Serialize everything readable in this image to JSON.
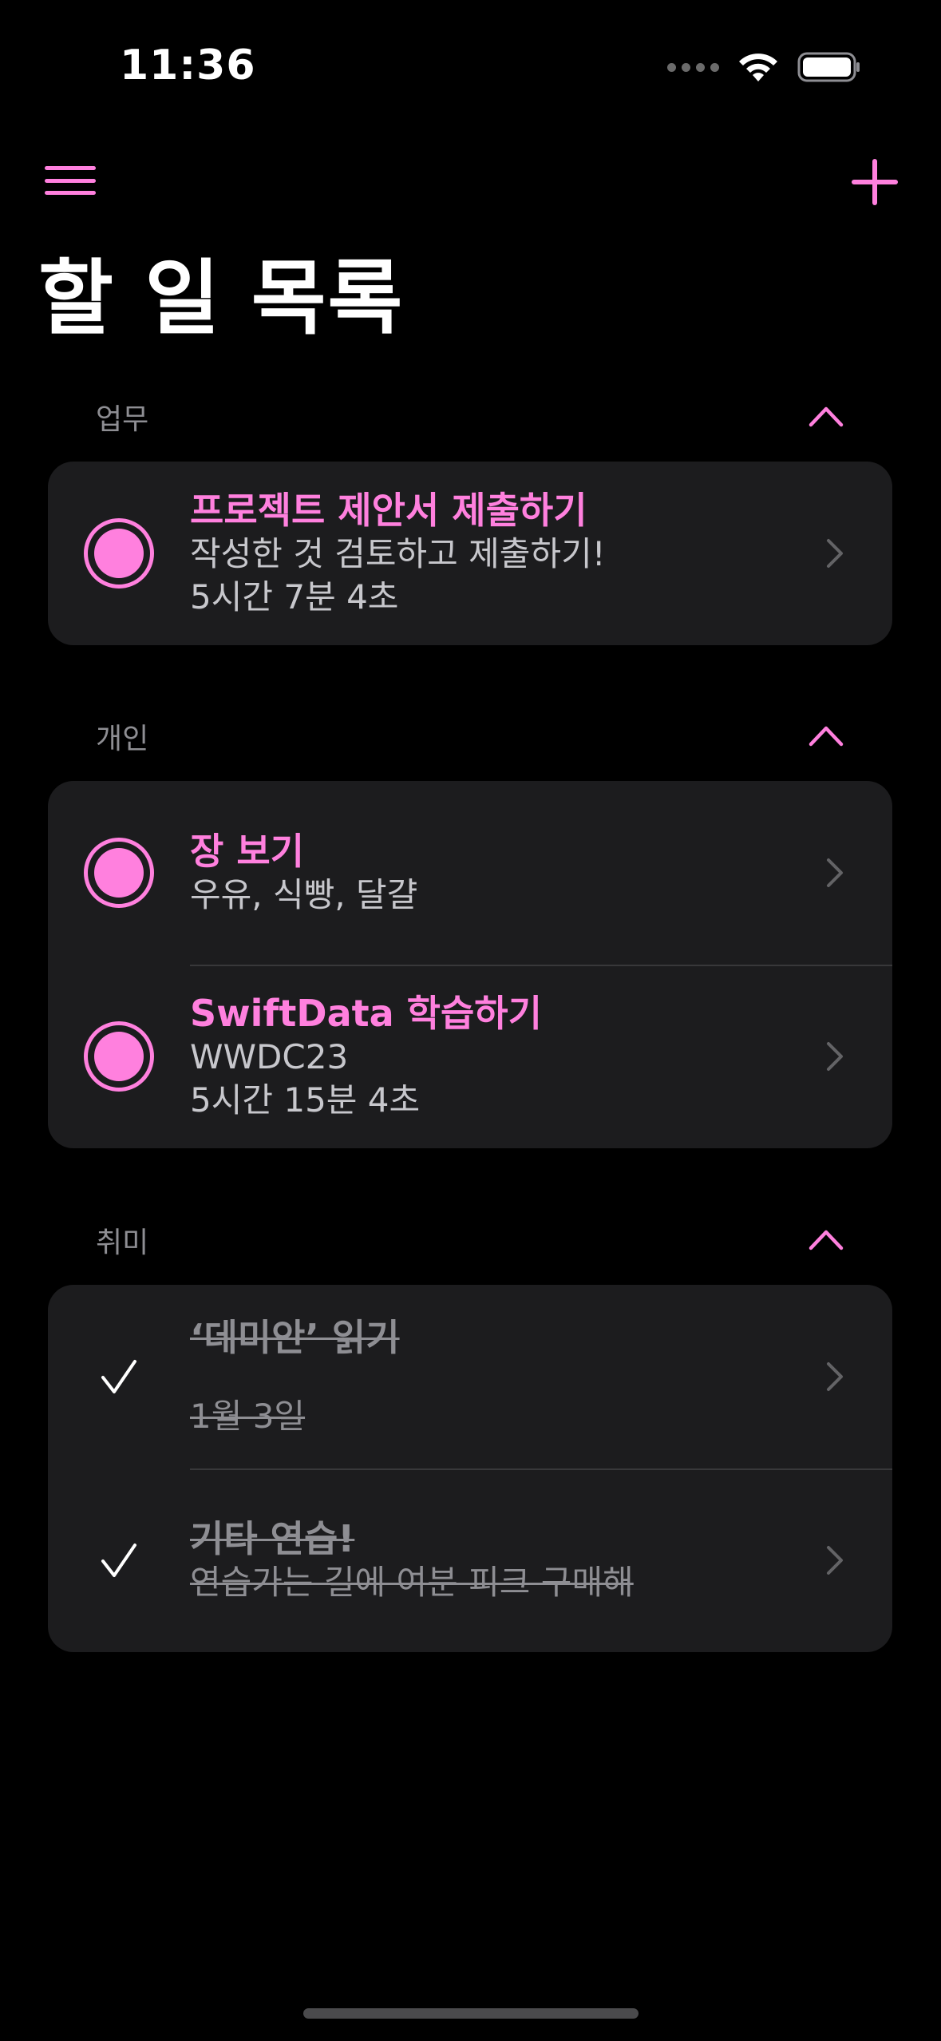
{
  "status_bar": {
    "time": "11:36"
  },
  "nav": {
    "title": "할 일 목록"
  },
  "colors": {
    "accent": "#ff80de",
    "background": "#000000",
    "card": "#1c1c1e",
    "secondary_text": "#8e8e93"
  },
  "sections": [
    {
      "label": "업무",
      "items": [
        {
          "title": "프로젝트 제안서 제출하기",
          "subtitle": "작성한 것 검토하고 제출하기!",
          "detail": "5시간 7분 4초",
          "completed": false
        }
      ]
    },
    {
      "label": "개인",
      "items": [
        {
          "title": "장 보기",
          "subtitle": "우유, 식빵, 달걀",
          "completed": false
        },
        {
          "title": "SwiftData 학습하기",
          "subtitle": "WWDC23",
          "detail": "5시간 15분 4초",
          "completed": false
        }
      ]
    },
    {
      "label": "취미",
      "items": [
        {
          "title": "‘데미안’ 읽기",
          "detail": "1월 3일",
          "completed": true
        },
        {
          "title": "기타 연습!",
          "subtitle": "연습가는 길에 여분 피크 구매해",
          "completed": true
        }
      ]
    }
  ],
  "icons": {
    "menu": "hamburger-menu-icon",
    "add": "plus-icon",
    "collapse": "chevron-up-icon",
    "disclosure": "chevron-right-icon",
    "incomplete": "radio-circle-icon",
    "complete": "checkmark-icon"
  }
}
